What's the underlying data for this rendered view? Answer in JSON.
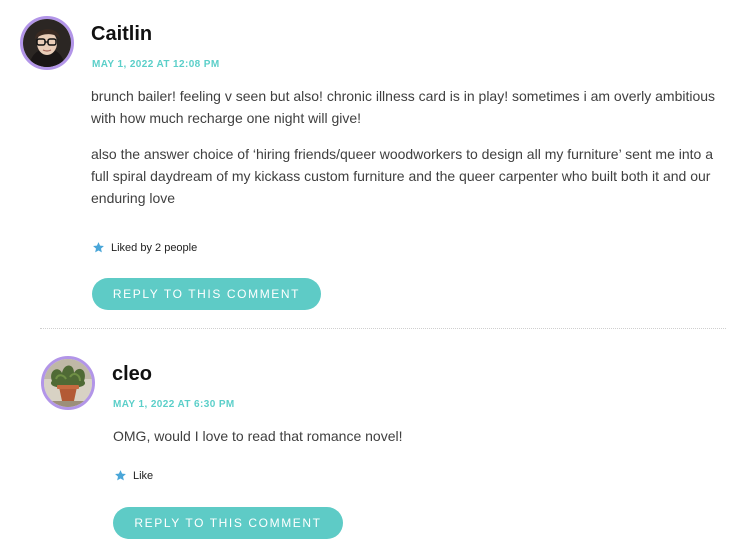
{
  "comments": [
    {
      "author": "Caitlin",
      "date": "MAY 1, 2022 AT 12:08 PM",
      "paragraphs": [
        "brunch bailer! feeling v seen but also! chronic illness card is in play! sometimes i am overly ambitious with how much recharge one night will give!",
        "also the answer choice of ‘hiring friends/queer woodworkers to design all my furniture’ sent me into a full spiral daydream of my kickass custom furniture and the queer carpenter who built both it and our enduring love"
      ],
      "like_text": "Liked by 2 people",
      "reply_label": "REPLY TO THIS COMMENT"
    },
    {
      "author": "cleo",
      "date": "MAY 1, 2022 AT 6:30 PM",
      "paragraphs": [
        "OMG, would I love to read that romance novel!"
      ],
      "like_text": "Like",
      "reply_label": "REPLY TO THIS COMMENT"
    }
  ],
  "colors": {
    "accent": "#5ecbc6",
    "date": "#5bcfc9",
    "avatar_ring": "#b295e8",
    "star": "#4aa6d8"
  },
  "icons": {
    "like": "star-icon"
  }
}
